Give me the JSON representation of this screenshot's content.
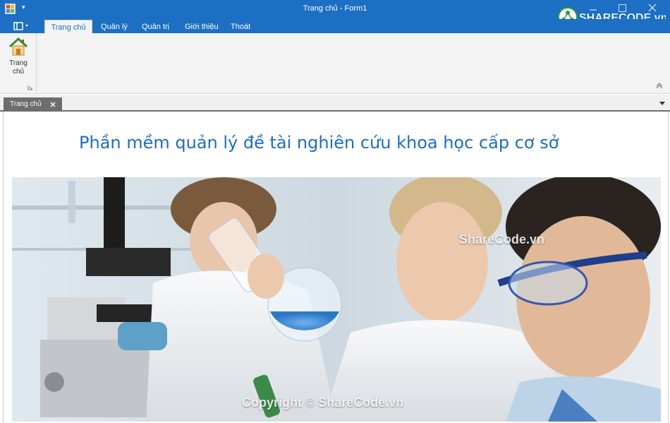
{
  "window": {
    "title": "Trang chủ - Form1"
  },
  "ribbon": {
    "tabs": [
      {
        "label": "Trang chủ",
        "active": true
      },
      {
        "label": "Quản lý",
        "active": false
      },
      {
        "label": "Quản trị",
        "active": false
      },
      {
        "label": "Giới thiệu",
        "active": false
      },
      {
        "label": "Thoát",
        "active": false
      }
    ],
    "home_button_label_line1": "Trang",
    "home_button_label_line2": "chủ"
  },
  "document_tab": {
    "label": "Trang chủ"
  },
  "content": {
    "heading": "Phần mềm quản lý đề tài nghiên cứu khoa học cấp cơ sở",
    "image_description_icon": "laboratory-scientists-image"
  },
  "watermarks": {
    "logo_text": "SHARECODE.vn",
    "mid_text": "ShareCode.vn",
    "bottom_text": "Copyright © ShareCode.vn"
  },
  "colors": {
    "accent": "#1c6fc2",
    "heading": "#1f6dbf",
    "ribbon_bg": "#f3f3f3",
    "doc_tab_bg": "#6d6d6d"
  }
}
